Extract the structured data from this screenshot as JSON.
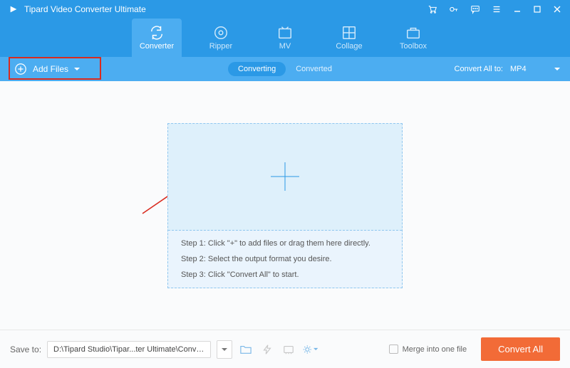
{
  "app": {
    "title": "Tipard Video Converter Ultimate"
  },
  "tabs": {
    "converter": "Converter",
    "ripper": "Ripper",
    "mv": "MV",
    "collage": "Collage",
    "toolbox": "Toolbox"
  },
  "subbar": {
    "add_files": "Add Files",
    "converting": "Converting",
    "converted": "Converted",
    "convert_all_to": "Convert All to:",
    "format": "MP4"
  },
  "dropzone": {
    "step1": "Step 1: Click \"+\" to add files or drag them here directly.",
    "step2": "Step 2: Select the output format you desire.",
    "step3": "Step 3: Click \"Convert All\" to start."
  },
  "bottom": {
    "save_to": "Save to:",
    "path": "D:\\Tipard Studio\\Tipar...ter Ultimate\\Converted",
    "merge": "Merge into one file",
    "convert_all": "Convert All"
  }
}
